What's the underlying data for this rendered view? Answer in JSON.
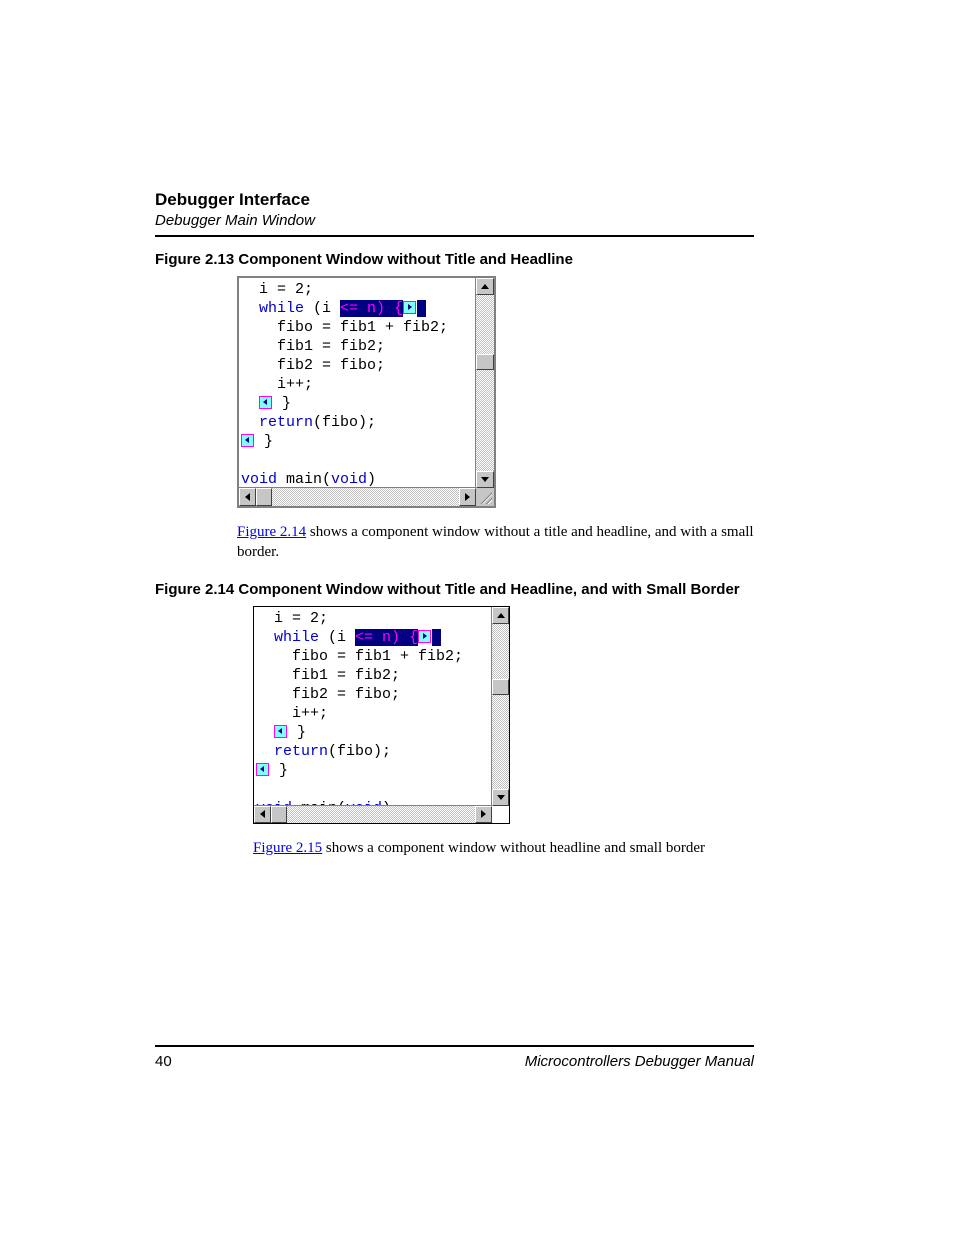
{
  "header": {
    "title": "Debugger Interface",
    "subtitle": "Debugger Main Window"
  },
  "figure1": {
    "caption": "Figure 2.13  Component Window without Title and Headline",
    "code": {
      "l1_a": "  i = 2;",
      "l2_a": "  ",
      "l2_kw": "while",
      "l2_b": " (i ",
      "l2_hl": "<= n) {",
      "l2_sp": " ",
      "l3": "    fibo = fib1 + fib2;",
      "l4": "    fib1 = fib2;",
      "l5": "    fib2 = fibo;",
      "l6": "    i++;",
      "l7_pre": "  ",
      "l7_post": " }",
      "l8_pre": "  ",
      "l8_kw": "return",
      "l8_post": "(fibo);",
      "l9_post": " }",
      "l11_kw": "void",
      "l11_a": " main(",
      "l11_kw2": "void",
      "l11_b": ")"
    }
  },
  "para1": {
    "link": "Figure 2.14",
    "rest": " shows a component window without a title and headline, and with a small border."
  },
  "figure2": {
    "caption": "Figure 2.14  Component Window without Title and Headline, and with Small Border",
    "code": {
      "l1_a": "  i = 2;",
      "l2_a": "  ",
      "l2_kw": "while",
      "l2_b": " (i ",
      "l2_hl": "<= n) {",
      "l2_sp": " ",
      "l3": "    fibo = fib1 + fib2;",
      "l4": "    fib1 = fib2;",
      "l5": "    fib2 = fibo;",
      "l6": "    i++;",
      "l7_pre": "  ",
      "l7_post": " }",
      "l8_pre": "  ",
      "l8_kw": "return",
      "l8_post": "(fibo);",
      "l9_post": " }",
      "l11_kw": "void",
      "l11_a": " main(",
      "l11_kw2": "void",
      "l11_b": ")"
    }
  },
  "para2": {
    "link": "Figure 2.15",
    "rest": " shows a component window without headline and small border"
  },
  "footer": {
    "page": "40",
    "book": "Microcontrollers Debugger Manual"
  }
}
